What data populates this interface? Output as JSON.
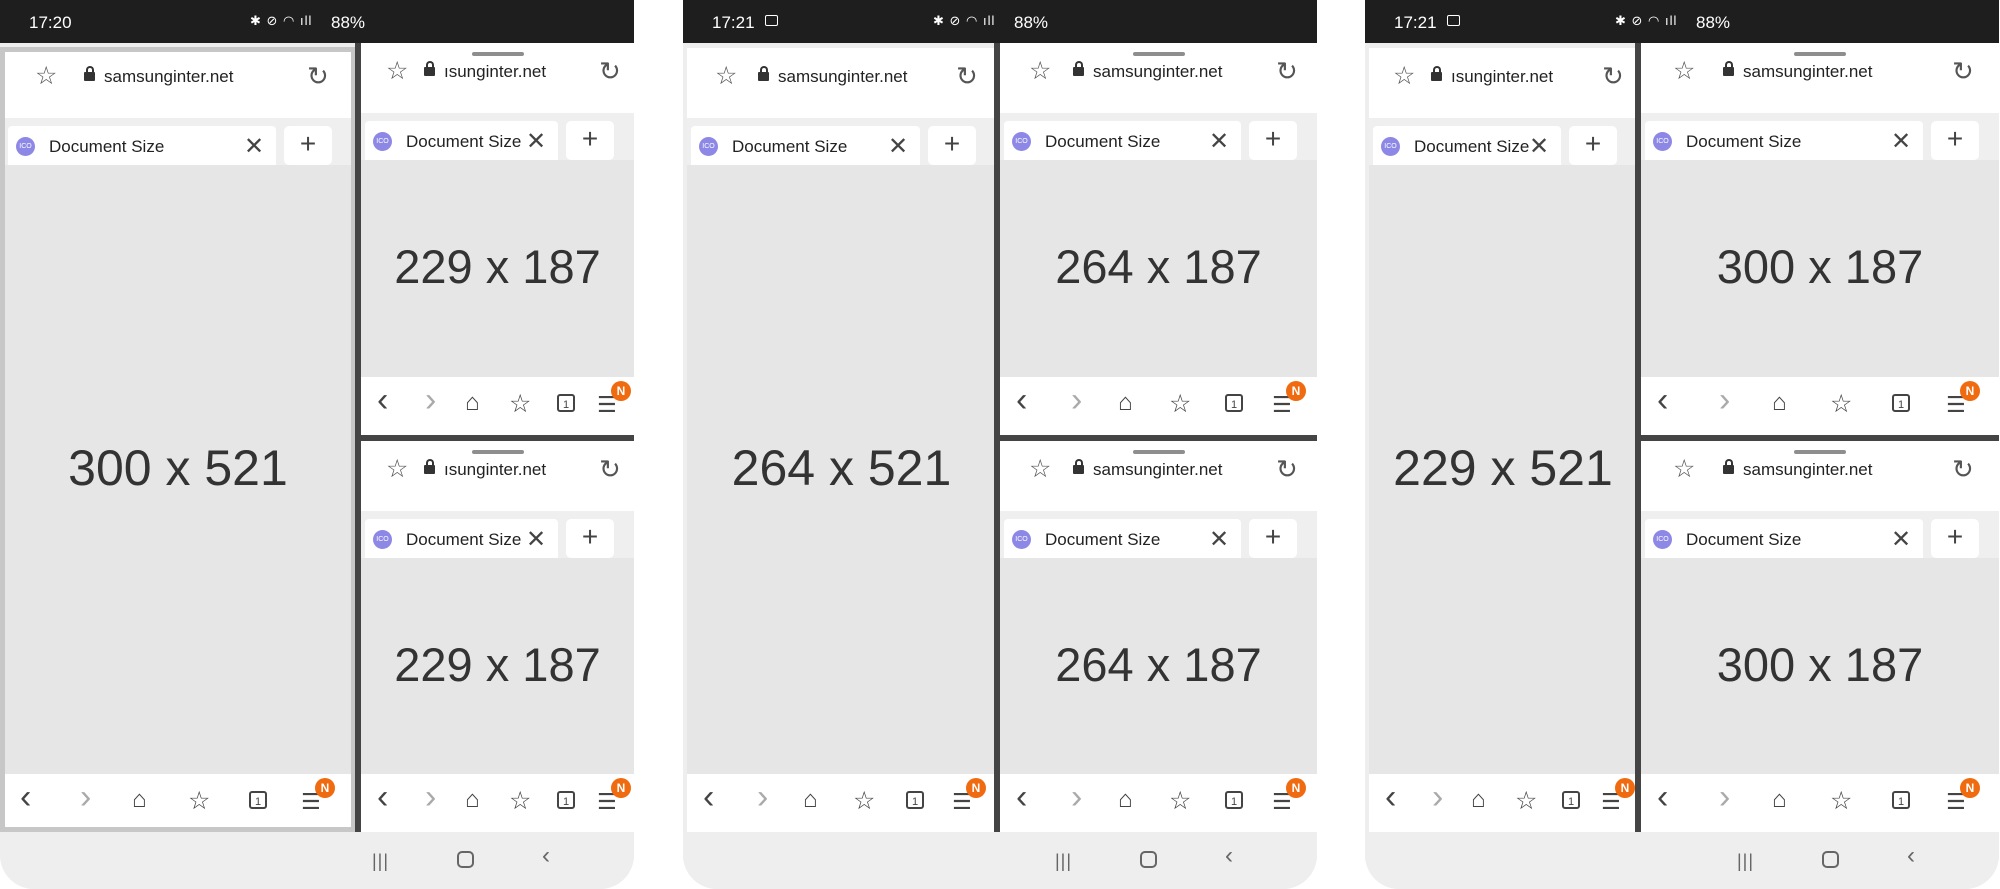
{
  "phones": [
    {
      "time": "17:20",
      "show_image_icon": false,
      "battery": "88%",
      "large": {
        "url": "samsunginter.net",
        "tab_title": "Document Size",
        "size_text": "300 x 521"
      },
      "top": {
        "url": "ısunginter.net",
        "tab_title": "Document Size",
        "size_text": "229 x 187"
      },
      "bottom": {
        "url": "ısunginter.net",
        "tab_title": "Document Size",
        "size_text": "229 x 187"
      }
    },
    {
      "time": "17:21",
      "show_image_icon": true,
      "battery": "88%",
      "large": {
        "url": "samsunginter.net",
        "tab_title": "Document Size",
        "size_text": "264 x 521"
      },
      "top": {
        "url": "samsunginter.net",
        "tab_title": "Document Size",
        "size_text": "264 x 187"
      },
      "bottom": {
        "url": "samsunginter.net",
        "tab_title": "Document Size",
        "size_text": "264 x 187"
      }
    },
    {
      "time": "17:21",
      "show_image_icon": true,
      "battery": "88%",
      "large": {
        "url": "ısunginter.net",
        "tab_title": "Document Size",
        "size_text": "229 x 521"
      },
      "top": {
        "url": "samsunginter.net",
        "tab_title": "Document Size",
        "size_text": "300 x 187"
      },
      "bottom": {
        "url": "samsunginter.net",
        "tab_title": "Document Size",
        "size_text": "300 x 187"
      }
    }
  ],
  "badge_label": "N",
  "tabs_count": "1",
  "colors": {
    "status_bar": "#1e1e1e",
    "content_bg": "#e6e6e6",
    "badge": "#f06a0f",
    "favicon": "#8d88e6",
    "divider": "#444444"
  }
}
